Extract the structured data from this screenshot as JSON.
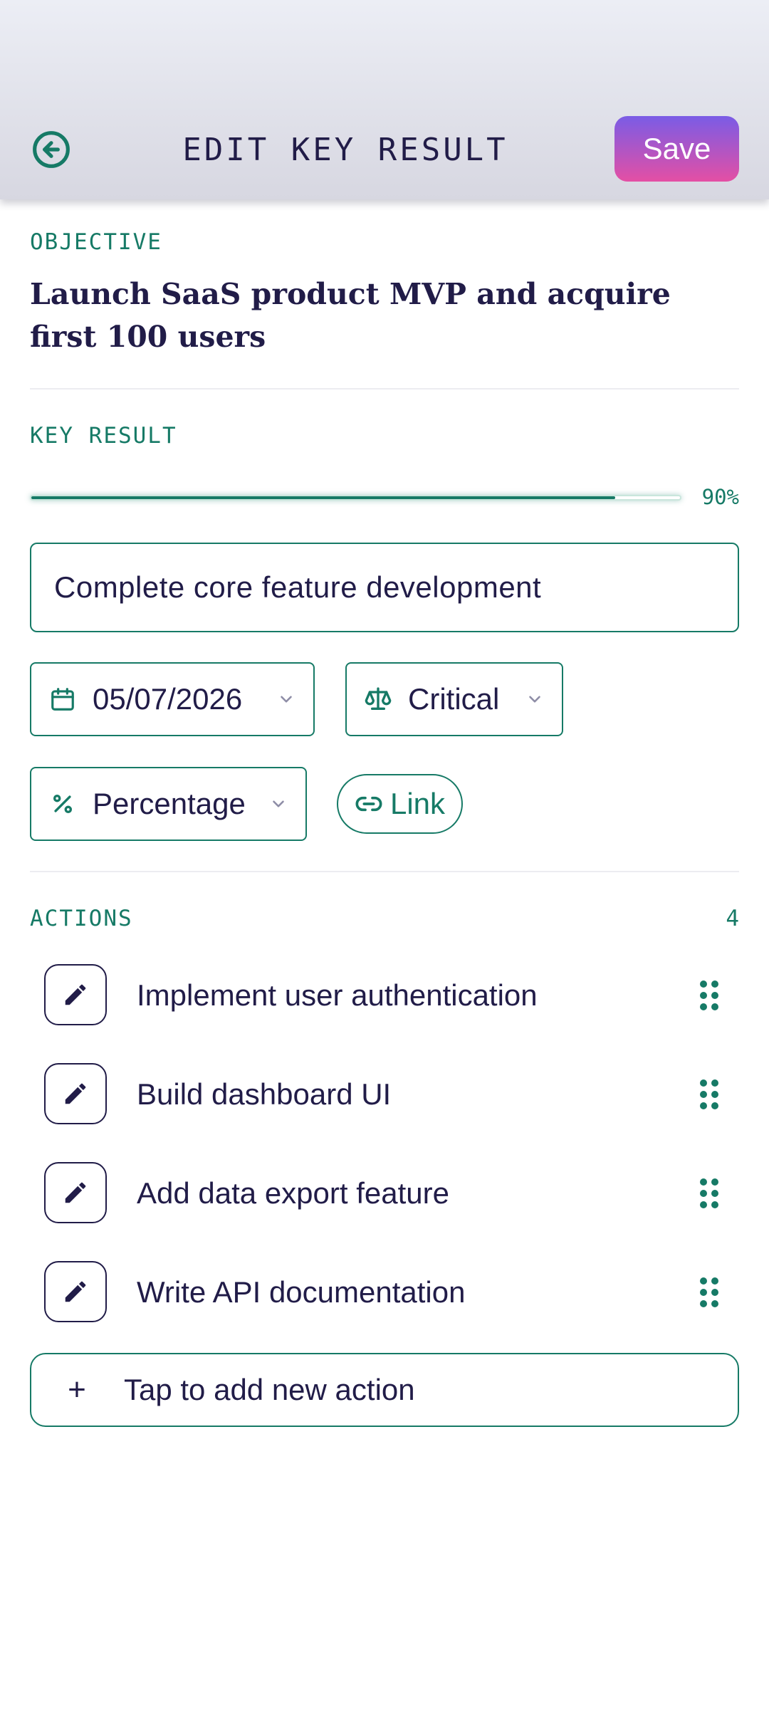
{
  "header": {
    "title": "EDIT KEY RESULT",
    "back_icon": "back-arrow-circle-icon",
    "save_label": "Save"
  },
  "objective": {
    "section_label": "OBJECTIVE",
    "text": "Launch SaaS product MVP and acquire first 100 users"
  },
  "key_result": {
    "section_label": "KEY RESULT",
    "progress": 0.9,
    "progress_label": "90%",
    "name_value": "Complete core feature development",
    "due_date": "05/07/2026",
    "priority": "Critical",
    "measure_type": "Percentage",
    "link_label": "Link"
  },
  "actions": {
    "section_label": "ACTIONS",
    "count": "4",
    "items": [
      {
        "label": "Implement user authentication"
      },
      {
        "label": "Build dashboard UI"
      },
      {
        "label": "Add data export feature"
      },
      {
        "label": "Write API documentation"
      }
    ],
    "add_label": "Tap to add new action",
    "add_icon": "+"
  },
  "colors": {
    "accent": "#167a66",
    "text": "#211c48",
    "save_gradient_top": "#7a5ce6",
    "save_gradient_bottom": "#e44fa4"
  }
}
